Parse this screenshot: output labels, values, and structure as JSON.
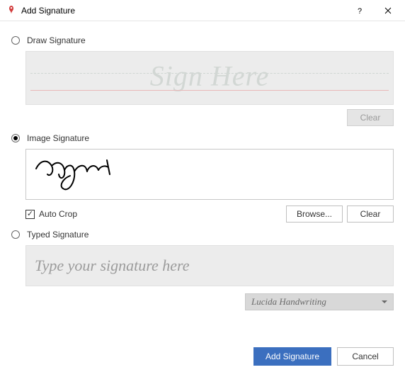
{
  "window": {
    "title": "Add Signature"
  },
  "sections": {
    "draw": {
      "label": "Draw Signature",
      "placeholder": "Sign Here",
      "clear_label": "Clear",
      "selected": false
    },
    "image": {
      "label": "Image Signature",
      "auto_crop_label": "Auto Crop",
      "auto_crop_checked": true,
      "browse_label": "Browse...",
      "clear_label": "Clear",
      "selected": true
    },
    "typed": {
      "label": "Typed Signature",
      "placeholder": "Type your signature here",
      "font_selected": "Lucida Handwriting",
      "selected": false
    }
  },
  "footer": {
    "primary_label": "Add Signature",
    "cancel_label": "Cancel"
  }
}
